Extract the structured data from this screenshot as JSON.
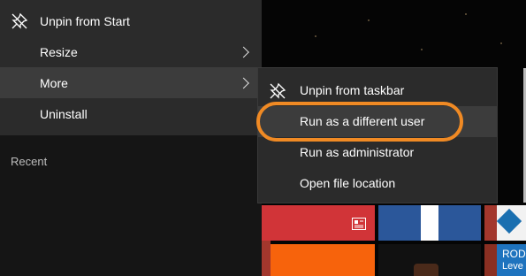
{
  "context_menu": {
    "items": [
      {
        "label": "Unpin from Start",
        "icon": "unpin-icon"
      },
      {
        "label": "Resize",
        "has_submenu": true
      },
      {
        "label": "More",
        "has_submenu": true,
        "highlighted": true
      },
      {
        "label": "Uninstall"
      }
    ]
  },
  "left_panel": {
    "section_label": "Recent"
  },
  "submenu": {
    "items": [
      {
        "label": "Unpin from taskbar",
        "icon": "unpin-icon"
      },
      {
        "label": "Run as a different user",
        "highlighted": true
      },
      {
        "label": "Run as administrator"
      },
      {
        "label": "Open file location"
      }
    ]
  },
  "tiles": {
    "partial_tile_text_line1": "ROD",
    "partial_tile_text_line2": "Leve"
  },
  "colors": {
    "menu_bg": "#2b2b2b",
    "hover_bg": "#3c3c3c",
    "highlight_ring": "#f08a24",
    "tile_red": "#d13438",
    "tile_blue": "#2b579a",
    "tile_orange": "#f7630c"
  }
}
